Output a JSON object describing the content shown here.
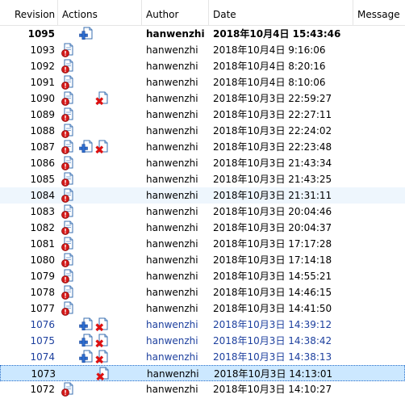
{
  "columns": {
    "revision": "Revision",
    "actions": "Actions",
    "author": "Author",
    "date": "Date",
    "message": "Message"
  },
  "icons": {
    "modify": "modified-document-icon",
    "add": "added-document-icon",
    "delete": "deleted-document-icon"
  },
  "colors": {
    "row_alt": "#eef6fd",
    "row_selected": "#cce8ff",
    "blue_text": "#1c3f9e"
  },
  "rows": [
    {
      "revision": "1095",
      "author": "hanwenzhi",
      "date": "2018年10月4日 15:43:46",
      "actions": [
        "",
        "add",
        ""
      ],
      "style": "bold"
    },
    {
      "revision": "1093",
      "author": "hanwenzhi",
      "date": "2018年10月4日 9:16:06",
      "actions": [
        "modify",
        "",
        ""
      ],
      "style": ""
    },
    {
      "revision": "1092",
      "author": "hanwenzhi",
      "date": "2018年10月4日 8:20:16",
      "actions": [
        "modify",
        "",
        ""
      ],
      "style": ""
    },
    {
      "revision": "1091",
      "author": "hanwenzhi",
      "date": "2018年10月4日 8:10:06",
      "actions": [
        "modify",
        "",
        ""
      ],
      "style": ""
    },
    {
      "revision": "1090",
      "author": "hanwenzhi",
      "date": "2018年10月3日 22:59:27",
      "actions": [
        "modify",
        "",
        "delete"
      ],
      "style": ""
    },
    {
      "revision": "1089",
      "author": "hanwenzhi",
      "date": "2018年10月3日 22:27:11",
      "actions": [
        "modify",
        "",
        ""
      ],
      "style": ""
    },
    {
      "revision": "1088",
      "author": "hanwenzhi",
      "date": "2018年10月3日 22:24:02",
      "actions": [
        "modify",
        "",
        ""
      ],
      "style": ""
    },
    {
      "revision": "1087",
      "author": "hanwenzhi",
      "date": "2018年10月3日 22:23:48",
      "actions": [
        "modify",
        "add",
        "delete"
      ],
      "style": ""
    },
    {
      "revision": "1086",
      "author": "hanwenzhi",
      "date": "2018年10月3日 21:43:34",
      "actions": [
        "modify",
        "",
        ""
      ],
      "style": ""
    },
    {
      "revision": "1085",
      "author": "hanwenzhi",
      "date": "2018年10月3日 21:43:25",
      "actions": [
        "modify",
        "",
        ""
      ],
      "style": ""
    },
    {
      "revision": "1084",
      "author": "hanwenzhi",
      "date": "2018年10月3日 21:31:11",
      "actions": [
        "modify",
        "",
        ""
      ],
      "style": "alt"
    },
    {
      "revision": "1083",
      "author": "hanwenzhi",
      "date": "2018年10月3日 20:04:46",
      "actions": [
        "modify",
        "",
        ""
      ],
      "style": ""
    },
    {
      "revision": "1082",
      "author": "hanwenzhi",
      "date": "2018年10月3日 20:04:37",
      "actions": [
        "modify",
        "",
        ""
      ],
      "style": ""
    },
    {
      "revision": "1081",
      "author": "hanwenzhi",
      "date": "2018年10月3日 17:17:28",
      "actions": [
        "modify",
        "",
        ""
      ],
      "style": ""
    },
    {
      "revision": "1080",
      "author": "hanwenzhi",
      "date": "2018年10月3日 17:14:18",
      "actions": [
        "modify",
        "",
        ""
      ],
      "style": ""
    },
    {
      "revision": "1079",
      "author": "hanwenzhi",
      "date": "2018年10月3日 14:55:21",
      "actions": [
        "modify",
        "",
        ""
      ],
      "style": ""
    },
    {
      "revision": "1078",
      "author": "hanwenzhi",
      "date": "2018年10月3日 14:46:15",
      "actions": [
        "modify",
        "",
        ""
      ],
      "style": ""
    },
    {
      "revision": "1077",
      "author": "hanwenzhi",
      "date": "2018年10月3日 14:41:50",
      "actions": [
        "modify",
        "",
        ""
      ],
      "style": ""
    },
    {
      "revision": "1076",
      "author": "hanwenzhi",
      "date": "2018年10月3日 14:39:12",
      "actions": [
        "",
        "add",
        "delete"
      ],
      "style": "blue"
    },
    {
      "revision": "1075",
      "author": "hanwenzhi",
      "date": "2018年10月3日 14:38:42",
      "actions": [
        "",
        "add",
        "delete"
      ],
      "style": "blue"
    },
    {
      "revision": "1074",
      "author": "hanwenzhi",
      "date": "2018年10月3日 14:38:13",
      "actions": [
        "",
        "add",
        "delete"
      ],
      "style": "blue"
    },
    {
      "revision": "1073",
      "author": "hanwenzhi",
      "date": "2018年10月3日 14:13:01",
      "actions": [
        "",
        "",
        "delete"
      ],
      "style": "sel"
    },
    {
      "revision": "1072",
      "author": "hanwenzhi",
      "date": "2018年10月3日 14:10:27",
      "actions": [
        "modify",
        "",
        ""
      ],
      "style": ""
    }
  ]
}
